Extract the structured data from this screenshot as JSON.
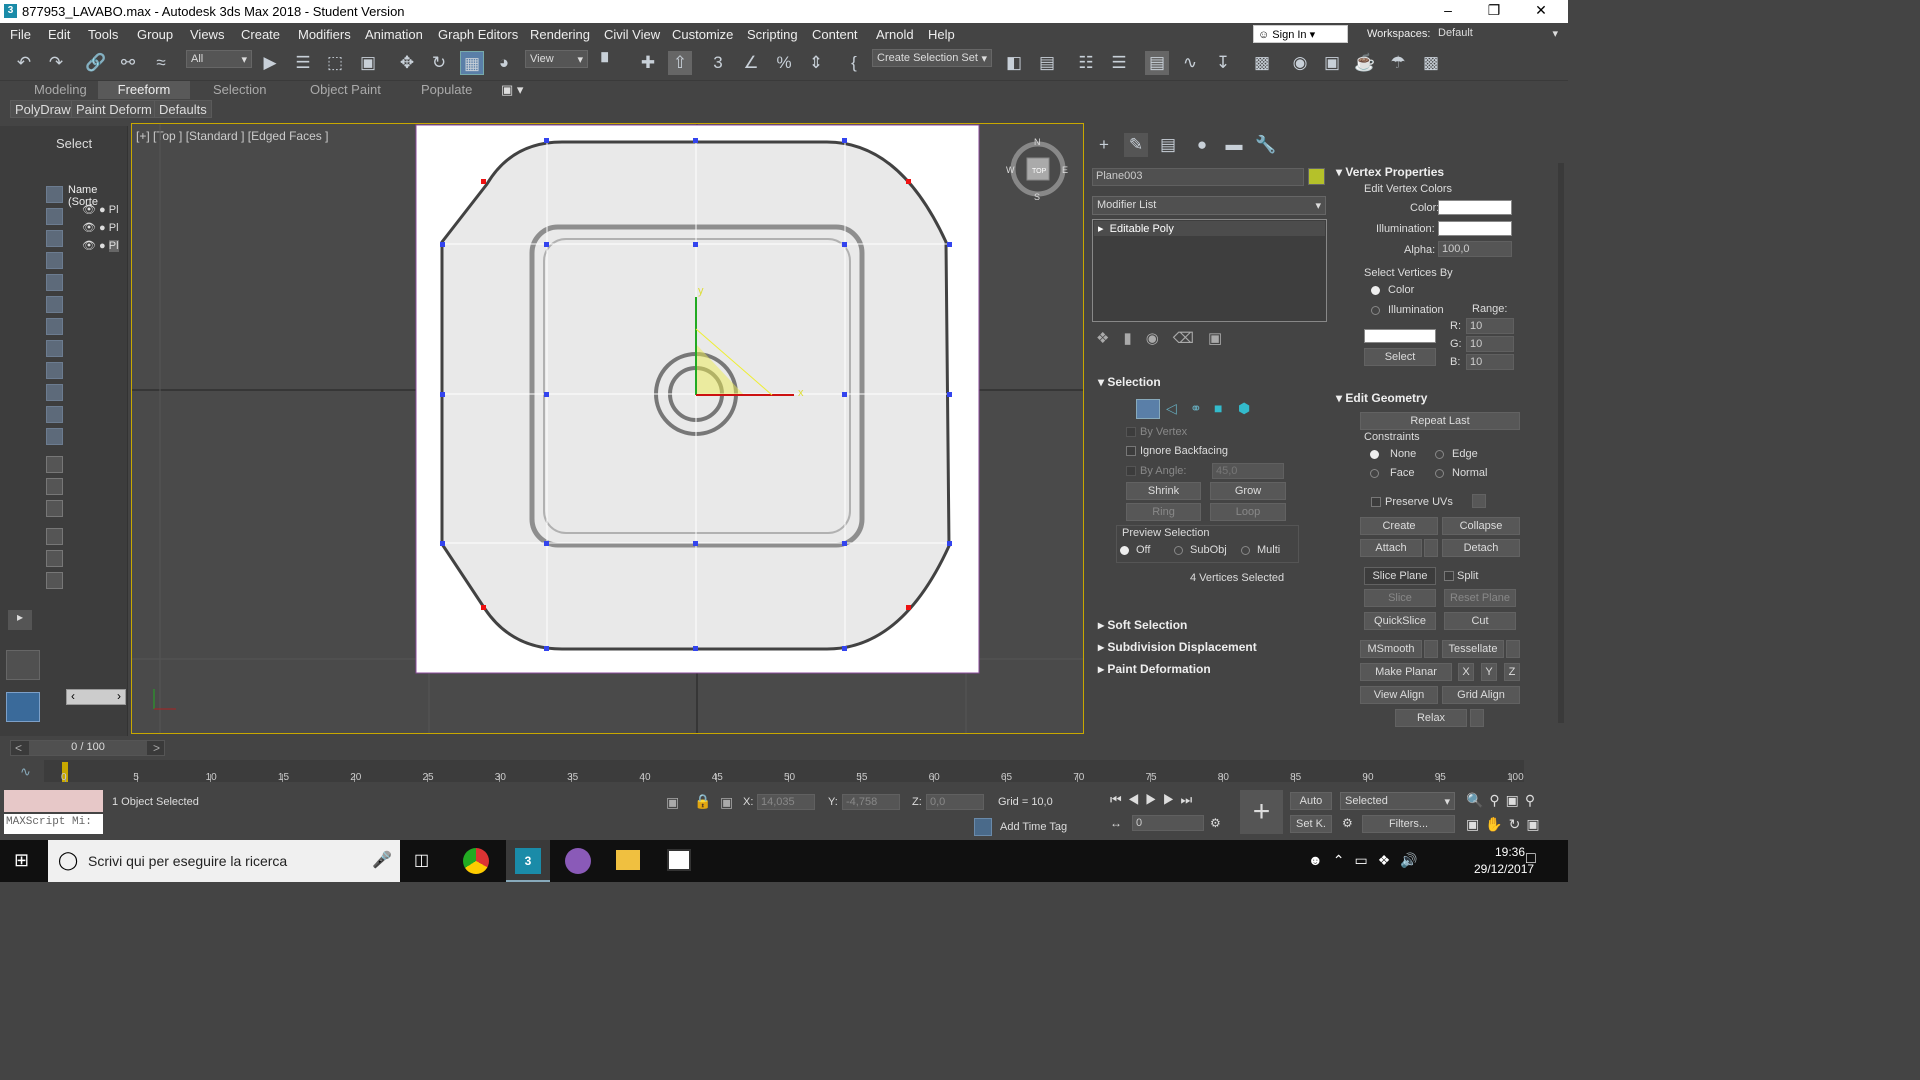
{
  "window": {
    "title": "877953_LAVABO.max - Autodesk 3ds Max 2018 - Student Version",
    "app_icon": "3"
  },
  "menu": [
    "File",
    "Edit",
    "Tools",
    "Group",
    "Views",
    "Create",
    "Modifiers",
    "Animation",
    "Graph Editors",
    "Rendering",
    "Civil View",
    "Customize",
    "Scripting",
    "Content",
    "Arnold",
    "Help"
  ],
  "signin": "Sign In",
  "workspaces_label": "Workspaces:",
  "workspaces_value": "Default",
  "toolbar": {
    "filter": "All",
    "refcoord": "View",
    "selset": "Create Selection Set"
  },
  "ribbon_tabs": [
    "Modeling",
    "Freeform",
    "Selection",
    "Object Paint",
    "Populate"
  ],
  "sub_tabs": [
    "PolyDraw",
    "Paint Deform",
    "Defaults"
  ],
  "scene": {
    "select": "Select",
    "col_header": "Name (Sorte",
    "rows": [
      "Pl",
      "Pl",
      "Pl"
    ]
  },
  "viewport": {
    "label": "[+] [Top ] [Standard ] [Edged Faces ]",
    "axis_x": "x",
    "axis_y": "y",
    "compass": {
      "n": "N",
      "s": "S",
      "e": "E",
      "w": "W",
      "top": "TOP"
    }
  },
  "cmd": {
    "object_name": "Plane003",
    "object_color": "#b5c12a",
    "modifier_list": "Modifier List",
    "stack_item": "Editable Poly",
    "selection": {
      "title": "Selection",
      "by_vertex": "By Vertex",
      "ignore_backfacing": "Ignore Backfacing",
      "by_angle": "By Angle:",
      "angle_value": "45,0",
      "shrink": "Shrink",
      "grow": "Grow",
      "ring": "Ring",
      "loop": "Loop",
      "preview": "Preview Selection",
      "off": "Off",
      "subobj": "SubObj",
      "multi": "Multi",
      "status": "4 Vertices Selected"
    },
    "rollouts": [
      "Soft Selection",
      "Subdivision Displacement",
      "Paint Deformation"
    ]
  },
  "vertex_props": {
    "title": "Vertex Properties",
    "edit_colors": "Edit Vertex Colors",
    "color": "Color:",
    "illumination": "Illumination:",
    "alpha": "Alpha:",
    "alpha_value": "100,0",
    "select_by": "Select Vertices By",
    "opt_color": "Color",
    "opt_illum": "Illumination",
    "range": "Range:",
    "r": "R:",
    "g": "G:",
    "b": "B:",
    "r_val": "10",
    "g_val": "10",
    "b_val": "10",
    "select_btn": "Select"
  },
  "edit_geometry": {
    "title": "Edit Geometry",
    "repeat_last": "Repeat Last",
    "constraints": "Constraints",
    "none": "None",
    "edge": "Edge",
    "face": "Face",
    "normal": "Normal",
    "preserve_uvs": "Preserve UVs",
    "create": "Create",
    "collapse": "Collapse",
    "attach": "Attach",
    "detach": "Detach",
    "slice_plane": "Slice Plane",
    "split": "Split",
    "slice": "Slice",
    "reset_plane": "Reset Plane",
    "quickslice": "QuickSlice",
    "cut": "Cut",
    "msmooth": "MSmooth",
    "tessellate": "Tessellate",
    "make_planar": "Make Planar",
    "x": "X",
    "y": "Y",
    "z": "Z",
    "view_align": "View Align",
    "grid_align": "Grid Align",
    "relax": "Relax"
  },
  "timeline": {
    "frame": "0 / 100",
    "ticks": [
      "0",
      "5",
      "10",
      "15",
      "20",
      "25",
      "30",
      "35",
      "40",
      "45",
      "50",
      "55",
      "60",
      "65",
      "70",
      "75",
      "80",
      "85",
      "90",
      "95",
      "100"
    ]
  },
  "status": {
    "maxscript": "MAXScript Mi:",
    "selected": "1 Object Selected",
    "x_label": "X:",
    "x_val": "14,035",
    "y_label": "Y:",
    "y_val": "-4,758",
    "z_label": "Z:",
    "z_val": "0,0",
    "grid": "Grid = 10,0",
    "add_time_tag": "Add Time Tag",
    "auto": "Auto",
    "setk": "Set K.",
    "selected_dd": "Selected",
    "filters": "Filters...",
    "frame_val": "0"
  },
  "taskbar": {
    "search": "Scrivi qui per eseguire la ricerca",
    "time": "19:36",
    "date": "29/12/2017"
  }
}
